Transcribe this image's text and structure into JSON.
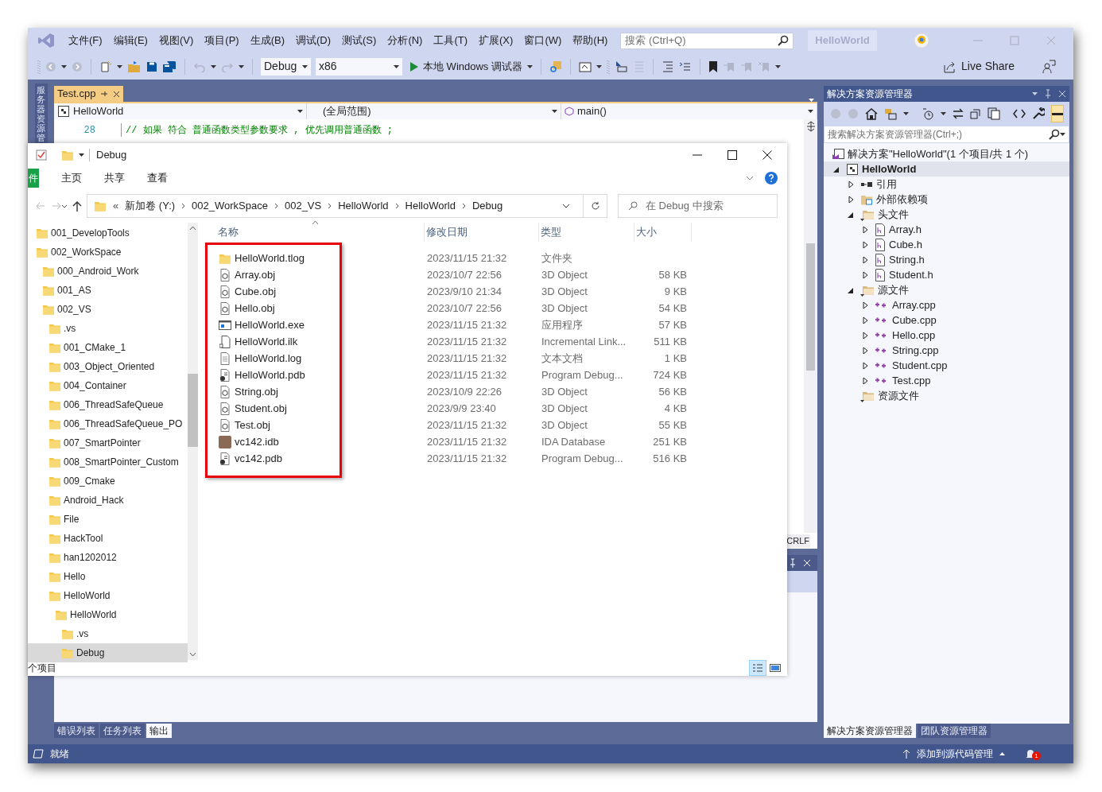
{
  "window": {
    "menus": [
      "文件(F)",
      "编辑(E)",
      "视图(V)",
      "项目(P)",
      "生成(B)",
      "调试(D)",
      "测试(S)",
      "分析(N)",
      "工具(T)",
      "扩展(X)",
      "窗口(W)",
      "帮助(H)"
    ],
    "search": {
      "placeholder": "搜索 (Ctrl+Q)"
    },
    "solution_name": "HelloWorld"
  },
  "toolbar": {
    "configuration": "Debug",
    "platform": "x86",
    "start_button": "本地 Windows 调试器",
    "live_share": "Live Share"
  },
  "side_strip": {
    "label": "服务器资源管"
  },
  "editor": {
    "tabs": [
      {
        "label": "Test.cpp",
        "selected": true
      }
    ],
    "navigation": [
      {
        "kind": "project",
        "label": "HelloWorld"
      },
      {
        "kind": "scope",
        "label": "(全局范围)"
      },
      {
        "kind": "member",
        "label": "main()"
      }
    ],
    "lines": [
      {
        "number": "28",
        "text": "// 如果 符合 普通函数类型参数要求 , 优先调用普通函数 ;"
      }
    ],
    "line_ending": "CRLF"
  },
  "explorer": {
    "title": "Debug",
    "ribbon_tabs": [
      {
        "kind": "file",
        "label": "件"
      },
      {
        "kind": "tab",
        "label": "主页"
      },
      {
        "kind": "tab",
        "label": "共享"
      },
      {
        "kind": "tab",
        "label": "查看"
      }
    ],
    "overflow_marker": "«",
    "breadcrumb": [
      "新加卷 (Y:)",
      "002_WorkSpace",
      "002_VS",
      "HelloWorld",
      "HelloWorld",
      "Debug"
    ],
    "search": {
      "placeholder": "在 Debug 中搜索"
    },
    "nav_tree": [
      {
        "label": "001_DevelopTools",
        "selected": false
      },
      {
        "label": "002_WorkSpace",
        "selected": false,
        "children": [
          {
            "label": "000_Android_Work",
            "selected": false
          },
          {
            "label": "001_AS",
            "selected": false
          },
          {
            "label": "002_VS",
            "selected": false,
            "children": [
              {
                "label": ".vs",
                "selected": false
              },
              {
                "label": "001_CMake_1",
                "selected": false
              },
              {
                "label": "003_Object_Oriented",
                "selected": false
              },
              {
                "label": "004_Container",
                "selected": false
              },
              {
                "label": "006_ThreadSafeQueue",
                "selected": false
              },
              {
                "label": "006_ThreadSafeQueue_PO",
                "selected": false
              },
              {
                "label": "007_SmartPointer",
                "selected": false
              },
              {
                "label": "008_SmartPointer_Custom",
                "selected": false
              },
              {
                "label": "009_Cmake",
                "selected": false
              },
              {
                "label": "Android_Hack",
                "selected": false
              },
              {
                "label": "File",
                "selected": false
              },
              {
                "label": "HackTool",
                "selected": false
              },
              {
                "label": "han1202012",
                "selected": false
              },
              {
                "label": "Hello",
                "selected": false
              },
              {
                "label": "HelloWorld",
                "selected": false,
                "children": [
                  {
                    "label": "HelloWorld",
                    "selected": false,
                    "children": [
                      {
                        "label": ".vs",
                        "selected": false
                      },
                      {
                        "label": "Debug",
                        "selected": true
                      }
                    ]
                  }
                ]
              }
            ]
          }
        ]
      }
    ],
    "columns": [
      "名称",
      "修改日期",
      "类型",
      "大小"
    ],
    "files": [
      {
        "kind": "folder",
        "name": "HelloWorld.tlog",
        "date": "2023/11/15 21:32",
        "type": "文件夹"
      },
      {
        "kind": "obj",
        "name": "Array.obj",
        "date": "2023/10/7 22:56",
        "type": "3D Object",
        "size": "58 KB"
      },
      {
        "kind": "obj",
        "name": "Cube.obj",
        "date": "2023/9/10 21:34",
        "type": "3D Object",
        "size": "9 KB"
      },
      {
        "kind": "obj",
        "name": "Hello.obj",
        "date": "2023/10/7 22:56",
        "type": "3D Object",
        "size": "54 KB"
      },
      {
        "kind": "exe",
        "name": "HelloWorld.exe",
        "date": "2023/11/15 21:32",
        "type": "应用程序",
        "size": "57 KB"
      },
      {
        "kind": "ilk",
        "name": "HelloWorld.ilk",
        "date": "2023/11/15 21:32",
        "type": "Incremental Link...",
        "size": "511 KB"
      },
      {
        "kind": "log",
        "name": "HelloWorld.log",
        "date": "2023/11/15 21:32",
        "type": "文本文档",
        "size": "1 KB"
      },
      {
        "kind": "pdb",
        "name": "HelloWorld.pdb",
        "date": "2023/11/15 21:32",
        "type": "Program Debug...",
        "size": "724 KB"
      },
      {
        "kind": "obj",
        "name": "String.obj",
        "date": "2023/10/9 22:26",
        "type": "3D Object",
        "size": "56 KB"
      },
      {
        "kind": "obj",
        "name": "Student.obj",
        "date": "2023/9/9 23:40",
        "type": "3D Object",
        "size": "4 KB"
      },
      {
        "kind": "obj",
        "name": "Test.obj",
        "date": "2023/11/15 21:32",
        "type": "3D Object",
        "size": "55 KB"
      },
      {
        "kind": "idb",
        "name": "vc142.idb",
        "date": "2023/11/15 21:32",
        "type": "IDA Database",
        "size": "251 KB"
      },
      {
        "kind": "pdb",
        "name": "vc142.pdb",
        "date": "2023/11/15 21:32",
        "type": "Program Debug...",
        "size": "516 KB"
      }
    ],
    "name_column_highlighted": true,
    "status": "个项目"
  },
  "output_panel": {
    "tabs": [
      {
        "label": "错误列表",
        "selected": false
      },
      {
        "label": "任务列表",
        "selected": false
      },
      {
        "label": "输出",
        "selected": true
      }
    ]
  },
  "solution_explorer": {
    "title": "解决方案资源管理器",
    "search": {
      "placeholder": "搜索解决方案资源管理器(Ctrl+;)"
    },
    "tree": [
      {
        "kind": "solution",
        "label": "解决方案\"HelloWorld\"(1 个项目/共 1 个)",
        "selected": false,
        "children": [
          {
            "kind": "project",
            "label": "HelloWorld",
            "selected": true,
            "expanded": true,
            "children": [
              {
                "kind": "references",
                "label": "引用",
                "selected": false,
                "expanded": false
              },
              {
                "kind": "external",
                "label": "外部依赖项",
                "selected": false,
                "expanded": false
              },
              {
                "kind": "filter",
                "label": "头文件",
                "selected": false,
                "expanded": true,
                "children": [
                  {
                    "kind": "header",
                    "label": "Array.h",
                    "selected": false,
                    "expanded": false
                  },
                  {
                    "kind": "header",
                    "label": "Cube.h",
                    "selected": false,
                    "expanded": false
                  },
                  {
                    "kind": "header",
                    "label": "String.h",
                    "selected": false,
                    "expanded": false
                  },
                  {
                    "kind": "header",
                    "label": "Student.h",
                    "selected": false,
                    "expanded": false
                  }
                ]
              },
              {
                "kind": "filter",
                "label": "源文件",
                "selected": false,
                "expanded": true,
                "children": [
                  {
                    "kind": "source",
                    "label": "Array.cpp",
                    "selected": false,
                    "expanded": false
                  },
                  {
                    "kind": "source",
                    "label": "Cube.cpp",
                    "selected": false,
                    "expanded": false
                  },
                  {
                    "kind": "source",
                    "label": "Hello.cpp",
                    "selected": false,
                    "expanded": false
                  },
                  {
                    "kind": "source",
                    "label": "String.cpp",
                    "selected": false,
                    "expanded": false
                  },
                  {
                    "kind": "source",
                    "label": "Student.cpp",
                    "selected": false,
                    "expanded": false
                  },
                  {
                    "kind": "source",
                    "label": "Test.cpp",
                    "selected": false,
                    "expanded": false
                  }
                ]
              },
              {
                "kind": "filter",
                "label": "资源文件",
                "selected": false
              }
            ]
          }
        ]
      }
    ],
    "tabs": [
      {
        "label": "解决方案资源管理器",
        "selected": true
      },
      {
        "label": "团队资源管理器",
        "selected": false
      }
    ]
  },
  "status_bar": {
    "text": "就绪",
    "source_control": "添加到源代码管理",
    "notifications": "1"
  }
}
